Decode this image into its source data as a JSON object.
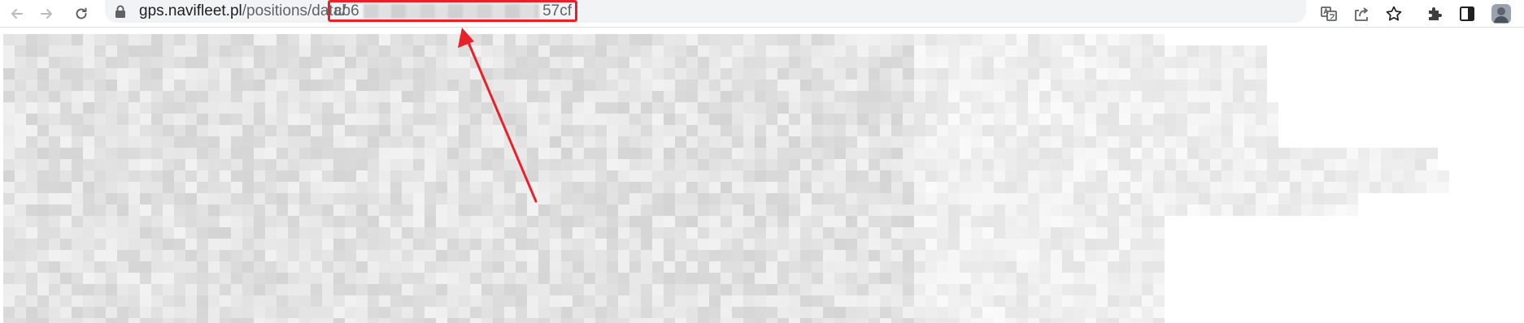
{
  "browser": {
    "url_host": "gps.navifleet.pl",
    "url_path": "/positions/data/",
    "url_id_start": "cb6",
    "url_id_end": "57cf"
  },
  "icons": {
    "back": "arrow-left-icon",
    "forward": "arrow-right-icon",
    "reload": "reload-icon",
    "lock": "lock-icon",
    "translate": "translate-icon",
    "share": "share-icon",
    "bookmark": "star-icon",
    "extensions": "puzzle-icon",
    "side_panel": "side-panel-icon",
    "profile": "avatar-icon"
  },
  "colors": {
    "annotation": "#e8202a",
    "toolbar_icon": "#5f6368",
    "blur_light": "#ececec",
    "blur_dark": "#d4d4d6"
  },
  "content": {
    "state": "pixelated / redacted page content"
  }
}
